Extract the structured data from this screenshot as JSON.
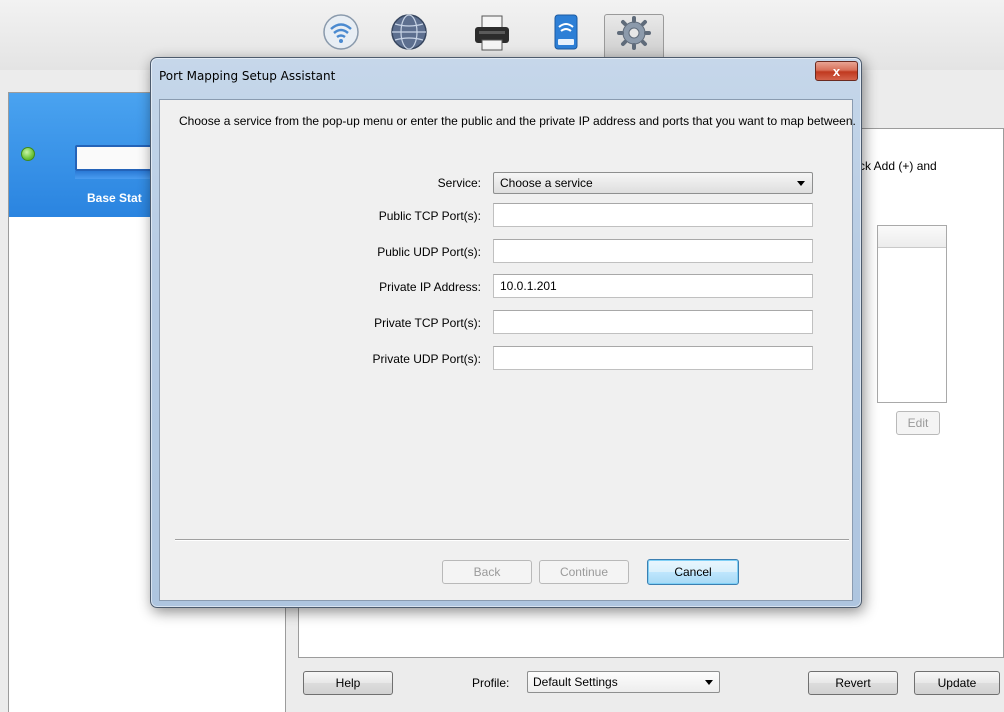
{
  "toolbar": {
    "icons": [
      "wifi-icon",
      "globe-icon",
      "printer-icon",
      "disk-icon",
      "gear-icon"
    ]
  },
  "sidebar": {
    "base_station_name": "Base Stat"
  },
  "panel": {
    "instruction_fragment": "ck Add (+) and",
    "edit_label": "Edit"
  },
  "footer": {
    "help_label": "Help",
    "profile_label": "Profile:",
    "profile_value": "Default Settings",
    "revert_label": "Revert",
    "update_label": "Update"
  },
  "dialog": {
    "title": "Port Mapping Setup Assistant",
    "close_glyph": "x",
    "description": "Choose a service from the pop-up menu or enter the public and the private IP address and ports that you want to map between.",
    "service_label": "Service:",
    "service_value": "Choose a service",
    "fields": [
      {
        "label": "Public TCP Port(s):",
        "value": ""
      },
      {
        "label": "Public UDP Port(s):",
        "value": ""
      },
      {
        "label": "Private IP Address:",
        "value": "10.0.1.201"
      },
      {
        "label": "Private TCP Port(s):",
        "value": ""
      },
      {
        "label": "Private UDP Port(s):",
        "value": ""
      }
    ],
    "back_label": "Back",
    "continue_label": "Continue",
    "cancel_label": "Cancel"
  }
}
